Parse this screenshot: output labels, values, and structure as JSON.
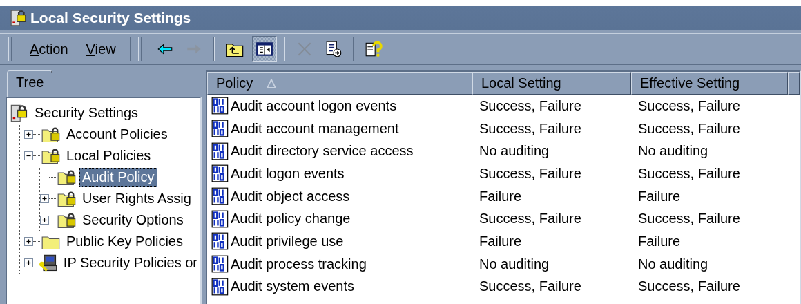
{
  "window": {
    "title": "Local Security Settings"
  },
  "menus": [
    {
      "label": "Action"
    },
    {
      "label": "View"
    }
  ],
  "toolbar": [
    {
      "kind": "back",
      "disabled": false,
      "pressed": false
    },
    {
      "kind": "forward",
      "disabled": true,
      "pressed": false
    },
    {
      "kind": "sep"
    },
    {
      "kind": "up",
      "disabled": false,
      "pressed": false
    },
    {
      "kind": "tree",
      "disabled": false,
      "pressed": true
    },
    {
      "kind": "sep"
    },
    {
      "kind": "delete",
      "disabled": true,
      "pressed": false
    },
    {
      "kind": "export",
      "disabled": false,
      "pressed": false
    },
    {
      "kind": "sep"
    },
    {
      "kind": "help",
      "disabled": false,
      "pressed": false
    }
  ],
  "tabs": [
    {
      "label": "Tree",
      "selected": true
    }
  ],
  "tree": [
    {
      "label": "Security Settings",
      "kind": "server",
      "selected": false,
      "children": [
        {
          "label": "Account Policies",
          "kind": "lockfolder",
          "expanded": false,
          "selected": false
        },
        {
          "label": "Local Policies",
          "kind": "lockfolder",
          "expanded": true,
          "selected": false,
          "children": [
            {
              "label": "Audit Policy",
              "kind": "lockfolder",
              "selected": true
            },
            {
              "label": "User Rights Assig",
              "kind": "lockfolder",
              "expanded": false,
              "selected": false
            },
            {
              "label": "Security Options",
              "kind": "lockfolder",
              "expanded": false,
              "selected": false
            }
          ]
        },
        {
          "label": "Public Key Policies",
          "kind": "folder",
          "expanded": false,
          "selected": false
        },
        {
          "label": "IP Security Policies or",
          "kind": "computer",
          "expanded": false,
          "selected": false
        }
      ]
    }
  ],
  "table": {
    "columns": [
      {
        "label": "Policy",
        "sorted": true
      },
      {
        "label": "Local Setting",
        "sorted": false
      },
      {
        "label": "Effective Setting",
        "sorted": false
      }
    ],
    "rows": [
      [
        "Audit account logon events",
        "Success, Failure",
        "Success, Failure"
      ],
      [
        "Audit account management",
        "Success, Failure",
        "Success, Failure"
      ],
      [
        "Audit directory service access",
        "No auditing",
        "No auditing"
      ],
      [
        "Audit logon events",
        "Success, Failure",
        "Success, Failure"
      ],
      [
        "Audit object access",
        "Failure",
        "Failure"
      ],
      [
        "Audit policy change",
        "Success, Failure",
        "Success, Failure"
      ],
      [
        "Audit privilege use",
        "Failure",
        "Failure"
      ],
      [
        "Audit process tracking",
        "No auditing",
        "No auditing"
      ],
      [
        "Audit system events",
        "Success, Failure",
        "Success, Failure"
      ]
    ]
  }
}
